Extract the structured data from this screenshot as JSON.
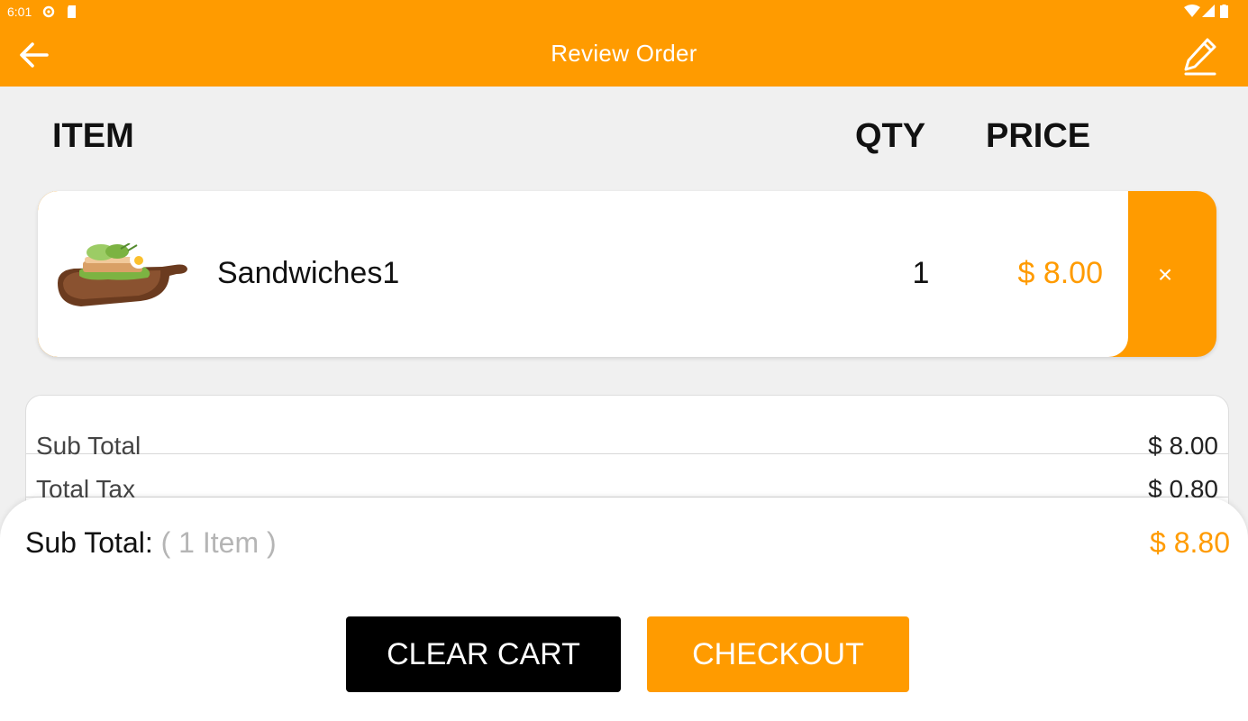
{
  "status": {
    "time": "6:01"
  },
  "appbar": {
    "title": "Review Order"
  },
  "columns": {
    "item": "ITEM",
    "qty": "QTY",
    "price": "PRICE"
  },
  "cart": {
    "items": [
      {
        "name": "Sandwiches1",
        "qty": "1",
        "price": "$ 8.00",
        "remove": "×"
      }
    ]
  },
  "totals": {
    "rows": [
      {
        "label": "Sub Total",
        "value": "$ 8.00"
      },
      {
        "label": "Total Tax",
        "value": "$ 0.80"
      }
    ]
  },
  "summary": {
    "label": "Sub Total:",
    "count": "( 1 Item )",
    "total": "$ 8.80"
  },
  "buttons": {
    "clear": "CLEAR CART",
    "checkout": "CHECKOUT"
  },
  "colors": {
    "accent": "#ff9b00",
    "dark": "#000000"
  }
}
